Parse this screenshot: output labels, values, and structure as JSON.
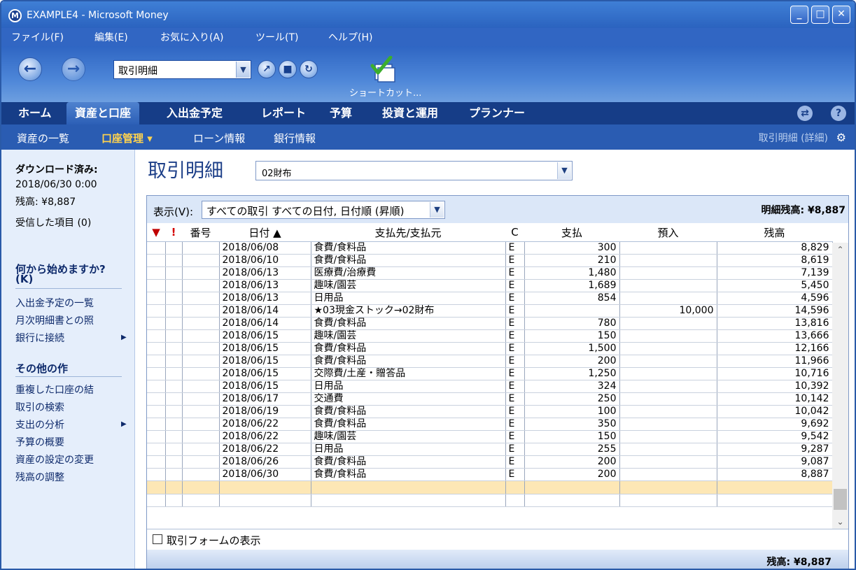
{
  "window": {
    "title": "EXAMPLE4 - Microsoft Money",
    "app_icon": "M",
    "minimize": "_",
    "maximize": "□",
    "close": "✕"
  },
  "menu": [
    "ファイル(F)",
    "編集(E)",
    "お気に入り(A)",
    "ツール(T)",
    "ヘルプ(H)"
  ],
  "toolbar": {
    "location": "取引明細",
    "back_icon": "back-arrow-icon",
    "forward_icon": "forward-arrow-icon",
    "shortcut_label": "ショートカット..."
  },
  "tabs": [
    "ホーム",
    "資産と口座",
    "入出金予定",
    "レポート",
    "予算",
    "投資と運用",
    "プランナー"
  ],
  "active_tab": "資産と口座",
  "subtabs": [
    "資産の一覧",
    "口座管理 ▾",
    "ローン情報",
    "銀行情報"
  ],
  "active_subtab": "口座管理 ▾",
  "subtab_right": "取引明細 (詳細)",
  "left_pane": {
    "download_head": "ダウンロード済み:",
    "download_date": "2018/06/30 0:00",
    "balance": "残高: ¥8,887",
    "received": "受信した項目 (0)",
    "start_head": "何から始めますか?",
    "start_key": "(K)",
    "start_links": [
      "入出金予定の一覧",
      "月次明細書との照",
      "銀行に接続"
    ],
    "other_head": "その他の作",
    "other_links": [
      "重複した口座の結",
      "取引の検索",
      "支出の分析",
      "予算の概要",
      "資産の設定の変更",
      "残高の調整"
    ]
  },
  "main": {
    "title": "取引明細",
    "account": "02財布",
    "view_label": "表示(V):",
    "view_value": "すべての取引 すべての日付, 日付順 (昇順)",
    "ending_balance": "明細残高: ¥8,887",
    "columns": {
      "flag": "▼",
      "excl": "!",
      "number": "番号",
      "date": "日付 ▲",
      "payee": "支払先/支払元",
      "c": "C",
      "payment": "支払",
      "deposit": "預入",
      "balance": "残高"
    },
    "rows": [
      {
        "date": "2018/06/08",
        "payee": "食費/食料品",
        "c": "E",
        "payment": "300",
        "deposit": "",
        "balance": "8,829"
      },
      {
        "date": "2018/06/10",
        "payee": "食費/食料品",
        "c": "E",
        "payment": "210",
        "deposit": "",
        "balance": "8,619"
      },
      {
        "date": "2018/06/13",
        "payee": "医療費/治療費",
        "c": "E",
        "payment": "1,480",
        "deposit": "",
        "balance": "7,139"
      },
      {
        "date": "2018/06/13",
        "payee": "趣味/園芸",
        "c": "E",
        "payment": "1,689",
        "deposit": "",
        "balance": "5,450"
      },
      {
        "date": "2018/06/13",
        "payee": "日用品",
        "c": "E",
        "payment": "854",
        "deposit": "",
        "balance": "4,596"
      },
      {
        "date": "2018/06/14",
        "payee": "★03現金ストック→02財布",
        "c": "E",
        "payment": "",
        "deposit": "10,000",
        "balance": "14,596"
      },
      {
        "date": "2018/06/14",
        "payee": "食費/食料品",
        "c": "E",
        "payment": "780",
        "deposit": "",
        "balance": "13,816"
      },
      {
        "date": "2018/06/15",
        "payee": "趣味/園芸",
        "c": "E",
        "payment": "150",
        "deposit": "",
        "balance": "13,666"
      },
      {
        "date": "2018/06/15",
        "payee": "食費/食料品",
        "c": "E",
        "payment": "1,500",
        "deposit": "",
        "balance": "12,166"
      },
      {
        "date": "2018/06/15",
        "payee": "食費/食料品",
        "c": "E",
        "payment": "200",
        "deposit": "",
        "balance": "11,966"
      },
      {
        "date": "2018/06/15",
        "payee": "交際費/土産・贈答品",
        "c": "E",
        "payment": "1,250",
        "deposit": "",
        "balance": "10,716"
      },
      {
        "date": "2018/06/15",
        "payee": "日用品",
        "c": "E",
        "payment": "324",
        "deposit": "",
        "balance": "10,392"
      },
      {
        "date": "2018/06/17",
        "payee": "交通費",
        "c": "E",
        "payment": "250",
        "deposit": "",
        "balance": "10,142"
      },
      {
        "date": "2018/06/19",
        "payee": "食費/食料品",
        "c": "E",
        "payment": "100",
        "deposit": "",
        "balance": "10,042"
      },
      {
        "date": "2018/06/22",
        "payee": "食費/食料品",
        "c": "E",
        "payment": "350",
        "deposit": "",
        "balance": "9,692"
      },
      {
        "date": "2018/06/22",
        "payee": "趣味/園芸",
        "c": "E",
        "payment": "150",
        "deposit": "",
        "balance": "9,542"
      },
      {
        "date": "2018/06/22",
        "payee": "日用品",
        "c": "E",
        "payment": "255",
        "deposit": "",
        "balance": "9,287"
      },
      {
        "date": "2018/06/26",
        "payee": "食費/食料品",
        "c": "E",
        "payment": "200",
        "deposit": "",
        "balance": "9,087"
      },
      {
        "date": "2018/06/30",
        "payee": "食費/食料品",
        "c": "E",
        "payment": "200",
        "deposit": "",
        "balance": "8,887"
      }
    ],
    "show_form_label": "取引フォームの表示",
    "footer_balance": "残高: ¥8,887"
  },
  "colors": {
    "title_blue": "#2b63bf",
    "tab_dark": "#163d87",
    "active_sub": "#ffd34e",
    "new_row": "#fde7b5"
  }
}
